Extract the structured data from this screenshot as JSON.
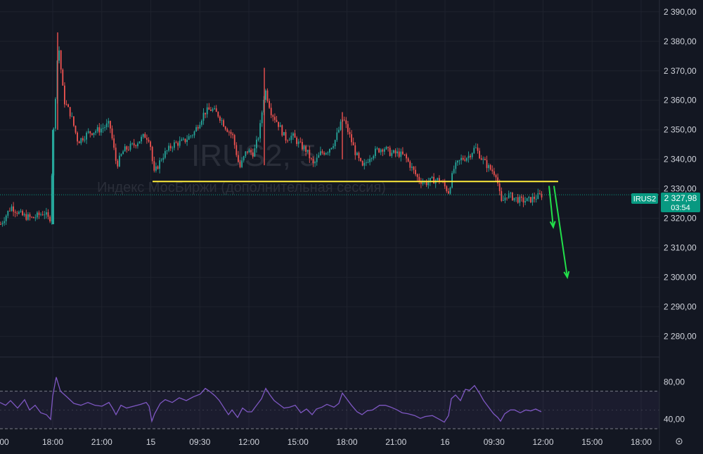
{
  "chart_data": {
    "type": "candlestick",
    "symbol_watermark": "IRUS2, 5",
    "subtitle_watermark": "Индекс МосБиржи (дополнительная сессия)",
    "price_axis": {
      "ylim": [
        2273,
        2394
      ],
      "ticks": [
        2390,
        2380,
        2370,
        2360,
        2350,
        2340,
        2330,
        2320,
        2310,
        2300,
        2290,
        2280
      ],
      "tick_labels": [
        "2 390,00",
        "2 380,00",
        "2 370,00",
        "2 360,00",
        "2 350,00",
        "2 340,00",
        "2 330,00",
        "2 320,00",
        "2 310,00",
        "2 300,00",
        "2 290,00",
        "2 280,00"
      ]
    },
    "time_axis": {
      "tick_labels": [
        "00",
        "18:00",
        "21:00",
        "15",
        "09:30",
        "12:00",
        "15:00",
        "18:00",
        "21:00",
        "16",
        "09:30",
        "12:00",
        "15:00",
        "18:00"
      ]
    },
    "price_path": [
      [
        0,
        2318
      ],
      [
        15,
        2324
      ],
      [
        30,
        2321
      ],
      [
        45,
        2320
      ],
      [
        62,
        2322
      ],
      [
        70,
        2319
      ],
      [
        75,
        2348
      ],
      [
        82,
        2380
      ],
      [
        90,
        2360
      ],
      [
        100,
        2355
      ],
      [
        110,
        2346
      ],
      [
        125,
        2349
      ],
      [
        140,
        2350
      ],
      [
        155,
        2352
      ],
      [
        165,
        2338
      ],
      [
        175,
        2343
      ],
      [
        190,
        2345
      ],
      [
        205,
        2348
      ],
      [
        212,
        2347
      ],
      [
        218,
        2335
      ],
      [
        230,
        2341
      ],
      [
        245,
        2345
      ],
      [
        260,
        2346
      ],
      [
        275,
        2349
      ],
      [
        290,
        2356
      ],
      [
        300,
        2357
      ],
      [
        310,
        2355
      ],
      [
        320,
        2351
      ],
      [
        330,
        2348
      ],
      [
        340,
        2337
      ],
      [
        350,
        2343
      ],
      [
        360,
        2342
      ],
      [
        368,
        2349
      ],
      [
        376,
        2364
      ],
      [
        385,
        2356
      ],
      [
        395,
        2352
      ],
      [
        405,
        2347
      ],
      [
        415,
        2348
      ],
      [
        425,
        2345
      ],
      [
        435,
        2343
      ],
      [
        445,
        2338
      ],
      [
        455,
        2342
      ],
      [
        465,
        2343
      ],
      [
        475,
        2346
      ],
      [
        487,
        2354
      ],
      [
        495,
        2349
      ],
      [
        505,
        2342
      ],
      [
        515,
        2337
      ],
      [
        525,
        2341
      ],
      [
        535,
        2343
      ],
      [
        545,
        2344
      ],
      [
        555,
        2342
      ],
      [
        565,
        2342
      ],
      [
        575,
        2341
      ],
      [
        585,
        2337
      ],
      [
        595,
        2333
      ],
      [
        605,
        2332
      ],
      [
        615,
        2333
      ],
      [
        625,
        2333
      ],
      [
        637,
        2329
      ],
      [
        645,
        2337
      ],
      [
        655,
        2340
      ],
      [
        665,
        2341
      ],
      [
        675,
        2344
      ],
      [
        685,
        2340
      ],
      [
        695,
        2337
      ],
      [
        705,
        2335
      ],
      [
        712,
        2325
      ],
      [
        720,
        2328
      ],
      [
        730,
        2327
      ],
      [
        740,
        2326
      ],
      [
        750,
        2326
      ],
      [
        760,
        2327
      ],
      [
        770,
        2328
      ]
    ],
    "annotations": {
      "support_level": 2332.5,
      "support_line_color": "#ffeb3b",
      "arrow_color": "#22e04a",
      "arrow1_price": [
        2331,
        2317
      ],
      "arrow2_price": [
        2331,
        2300
      ]
    },
    "last_price": {
      "symbol": "IRUS2",
      "price": "2 327,98",
      "countdown": "03:54",
      "color": "#089981"
    },
    "rsi": {
      "ylim": [
        30,
        90
      ],
      "upper_level": 70,
      "lower_level": 30,
      "labels": [
        "80,00",
        "40,00"
      ],
      "line_color": "#7e57c2",
      "values": [
        [
          0,
          58
        ],
        [
          8,
          55
        ],
        [
          15,
          60
        ],
        [
          25,
          52
        ],
        [
          35,
          61
        ],
        [
          42,
          50
        ],
        [
          50,
          55
        ],
        [
          58,
          47
        ],
        [
          66,
          45
        ],
        [
          72,
          40
        ],
        [
          75,
          65
        ],
        [
          80,
          85
        ],
        [
          86,
          70
        ],
        [
          95,
          64
        ],
        [
          105,
          57
        ],
        [
          115,
          55
        ],
        [
          125,
          58
        ],
        [
          135,
          55
        ],
        [
          145,
          54
        ],
        [
          155,
          58
        ],
        [
          160,
          52
        ],
        [
          165,
          45
        ],
        [
          172,
          55
        ],
        [
          180,
          52
        ],
        [
          190,
          54
        ],
        [
          200,
          56
        ],
        [
          208,
          58
        ],
        [
          212,
          54
        ],
        [
          216,
          38
        ],
        [
          220,
          46
        ],
        [
          228,
          57
        ],
        [
          235,
          61
        ],
        [
          245,
          58
        ],
        [
          255,
          63
        ],
        [
          265,
          60
        ],
        [
          275,
          64
        ],
        [
          285,
          67
        ],
        [
          292,
          73
        ],
        [
          298,
          70
        ],
        [
          306,
          65
        ],
        [
          312,
          60
        ],
        [
          318,
          53
        ],
        [
          325,
          45
        ],
        [
          330,
          50
        ],
        [
          338,
          42
        ],
        [
          345,
          52
        ],
        [
          352,
          48
        ],
        [
          358,
          48
        ],
        [
          365,
          55
        ],
        [
          372,
          62
        ],
        [
          378,
          73
        ],
        [
          384,
          66
        ],
        [
          390,
          60
        ],
        [
          397,
          56
        ],
        [
          404,
          52
        ],
        [
          412,
          53
        ],
        [
          420,
          55
        ],
        [
          428,
          47
        ],
        [
          436,
          51
        ],
        [
          444,
          45
        ],
        [
          450,
          51
        ],
        [
          458,
          53
        ],
        [
          465,
          56
        ],
        [
          475,
          53
        ],
        [
          482,
          57
        ],
        [
          487,
          68
        ],
        [
          492,
          63
        ],
        [
          500,
          55
        ],
        [
          508,
          48
        ],
        [
          515,
          45
        ],
        [
          522,
          49
        ],
        [
          530,
          50
        ],
        [
          540,
          55
        ],
        [
          548,
          55
        ],
        [
          556,
          53
        ],
        [
          565,
          50
        ],
        [
          572,
          47
        ],
        [
          580,
          46
        ],
        [
          590,
          44
        ],
        [
          598,
          41
        ],
        [
          605,
          43
        ],
        [
          615,
          44
        ],
        [
          625,
          40
        ],
        [
          632,
          37
        ],
        [
          638,
          44
        ],
        [
          642,
          62
        ],
        [
          648,
          66
        ],
        [
          655,
          60
        ],
        [
          662,
          72
        ],
        [
          668,
          71
        ],
        [
          675,
          76
        ],
        [
          682,
          68
        ],
        [
          688,
          60
        ],
        [
          695,
          53
        ],
        [
          702,
          46
        ],
        [
          708,
          42
        ],
        [
          712,
          38
        ],
        [
          718,
          46
        ],
        [
          726,
          50
        ],
        [
          732,
          50
        ],
        [
          740,
          47
        ],
        [
          748,
          50
        ],
        [
          755,
          49
        ],
        [
          762,
          51
        ],
        [
          770,
          48
        ]
      ]
    }
  }
}
